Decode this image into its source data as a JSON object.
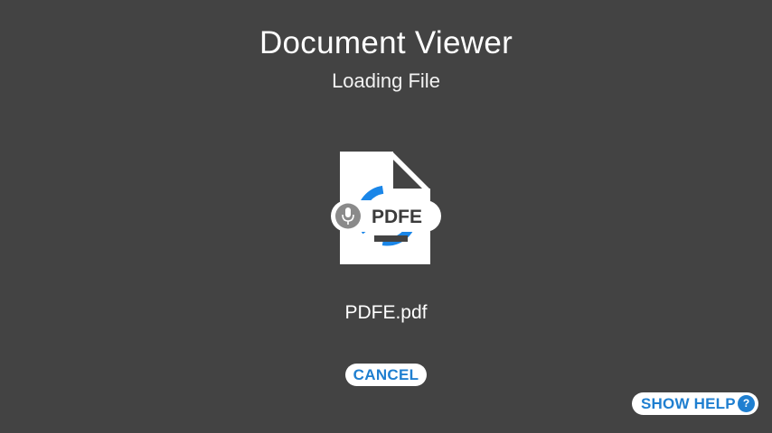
{
  "header": {
    "title": "Document Viewer",
    "subtitle": "Loading File"
  },
  "document": {
    "icon_badge_text": "PDFE",
    "filename": "PDFE.pdf"
  },
  "actions": {
    "cancel_label": "CANCEL",
    "help_label": "SHOW HELP",
    "help_icon_glyph": "?"
  },
  "icons": {
    "document": "document-icon",
    "spinner": "loading-spinner-icon",
    "microphone": "microphone-icon",
    "help": "question-icon"
  },
  "colors": {
    "background": "#434343",
    "accent": "#1f7fd0",
    "spinner": "#1a86e8"
  }
}
